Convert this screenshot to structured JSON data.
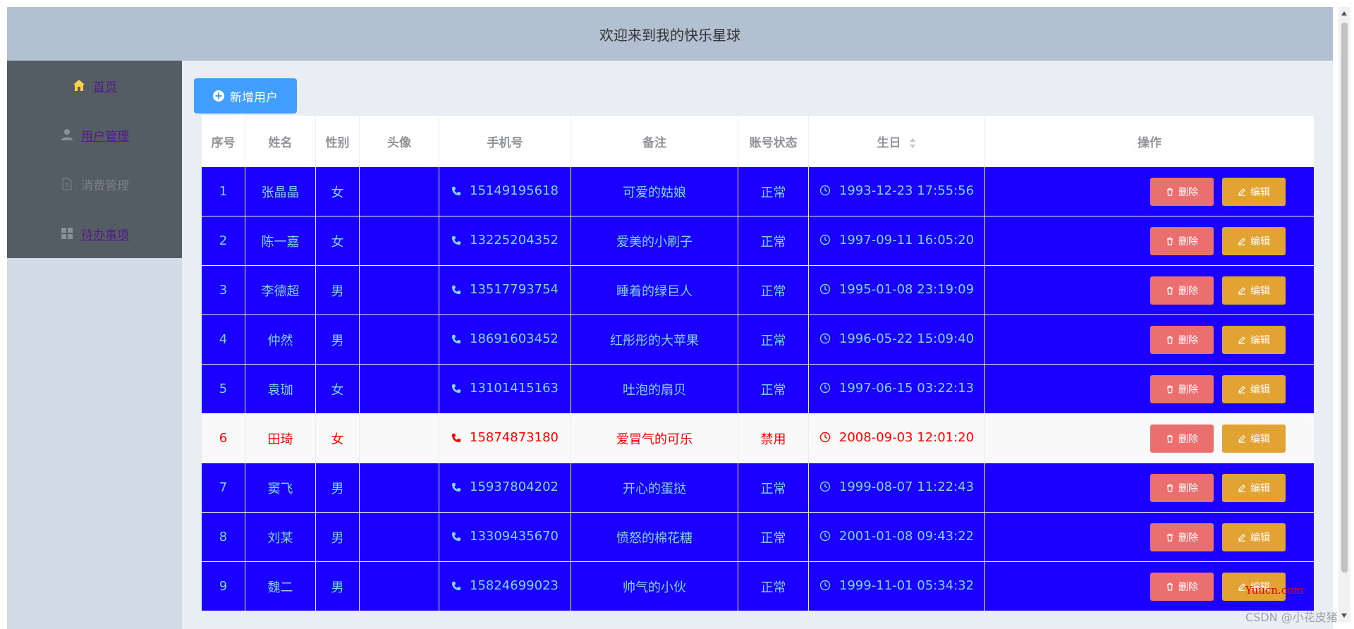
{
  "header": {
    "title": "欢迎来到我的快乐星球"
  },
  "sidebar": {
    "items": [
      {
        "label": "首页",
        "icon": "home-icon",
        "color": "#ffd04b"
      },
      {
        "label": "用户管理",
        "icon": "user-icon"
      },
      {
        "label": "消费管理",
        "icon": "document-icon"
      },
      {
        "label": "待办事项",
        "icon": "grid-icon"
      }
    ]
  },
  "toolbar": {
    "add_label": "新增用户"
  },
  "table": {
    "columns": [
      "序号",
      "姓名",
      "性别",
      "头像",
      "手机号",
      "备注",
      "账号状态",
      "生日",
      "操作"
    ],
    "rows": [
      {
        "index": "1",
        "name": "张晶晶",
        "gender": "女",
        "avatar": "",
        "phone": "15149195618",
        "note": "可爱的姑娘",
        "status": "正常",
        "birthday": "1993-12-23 17:55:56",
        "state": "normal"
      },
      {
        "index": "2",
        "name": "陈一嘉",
        "gender": "女",
        "avatar": "",
        "phone": "13225204352",
        "note": "爱美的小刷子",
        "status": "正常",
        "birthday": "1997-09-11 16:05:20",
        "state": "normal"
      },
      {
        "index": "3",
        "name": "李德超",
        "gender": "男",
        "avatar": "",
        "phone": "13517793754",
        "note": "睡着的绿巨人",
        "status": "正常",
        "birthday": "1995-01-08 23:19:09",
        "state": "normal"
      },
      {
        "index": "4",
        "name": "仲然",
        "gender": "男",
        "avatar": "",
        "phone": "18691603452",
        "note": "红彤彤的大苹果",
        "status": "正常",
        "birthday": "1996-05-22 15:09:40",
        "state": "normal"
      },
      {
        "index": "5",
        "name": "袁珈",
        "gender": "女",
        "avatar": "",
        "phone": "13101415163",
        "note": "吐泡的扇贝",
        "status": "正常",
        "birthday": "1997-06-15 03:22:13",
        "state": "normal"
      },
      {
        "index": "6",
        "name": "田琦",
        "gender": "女",
        "avatar": "",
        "phone": "15874873180",
        "note": "爱冒气的可乐",
        "status": "禁用",
        "birthday": "2008-09-03 12:01:20",
        "state": "disabled"
      },
      {
        "index": "7",
        "name": "窦飞",
        "gender": "男",
        "avatar": "",
        "phone": "15937804202",
        "note": "开心的蛋挞",
        "status": "正常",
        "birthday": "1999-08-07 11:22:43",
        "state": "normal"
      },
      {
        "index": "8",
        "name": "刘某",
        "gender": "男",
        "avatar": "",
        "phone": "13309435670",
        "note": "愤怒的棉花糖",
        "status": "正常",
        "birthday": "2001-01-08 09:43:22",
        "state": "normal"
      },
      {
        "index": "9",
        "name": "魏二",
        "gender": "男",
        "avatar": "",
        "phone": "15824699023",
        "note": "帅气的小伙",
        "status": "正常",
        "birthday": "1999-11-01 05:34:32",
        "state": "normal"
      }
    ],
    "actions": {
      "delete_label": "删除",
      "edit_label": "编辑"
    }
  },
  "watermark": {
    "site": "Yuucn.com",
    "credit": "CSDN @小花皮猪"
  },
  "colors": {
    "header_bg": "#b3c0d1",
    "menu_bg": "#545c64",
    "primary": "#409eff",
    "row_normal_bg": "#1b00ff",
    "row_normal_text": "#7fd4e8",
    "row_disabled_text": "#ff0000",
    "delete_button": "#eb6f6f",
    "edit_button": "#e3a333"
  }
}
